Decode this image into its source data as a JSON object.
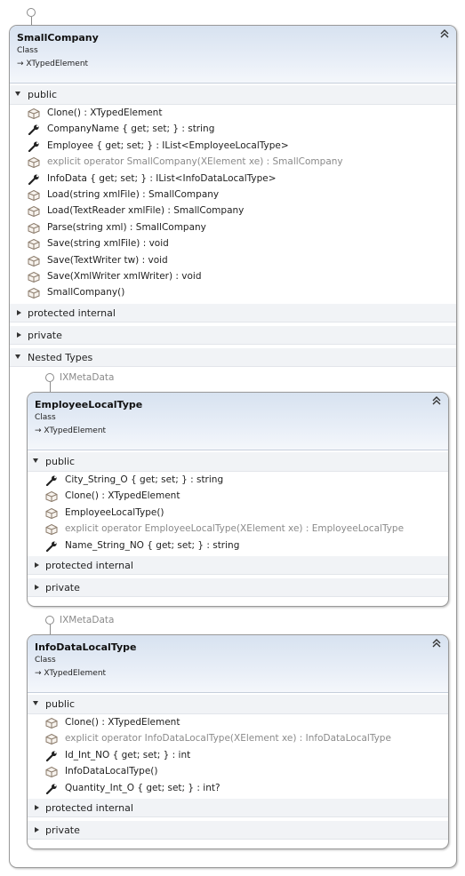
{
  "outer_interface": {
    "label": ""
  },
  "small_company": {
    "title": "SmallCompany",
    "kind": "Class",
    "base": "XTypedElement",
    "sections": {
      "public": "public",
      "protected_internal": "protected internal",
      "private": "private",
      "nested": "Nested Types"
    },
    "members": [
      {
        "text": "Clone() : XTypedElement",
        "icon": "method-icon",
        "gray": false
      },
      {
        "text": "CompanyName { get; set; } : string",
        "icon": "property-icon",
        "gray": false
      },
      {
        "text": "Employee { get; set; } : IList<EmployeeLocalType>",
        "icon": "property-icon",
        "gray": false
      },
      {
        "text": "explicit operator SmallCompany(XElement xe) : SmallCompany",
        "icon": "method-icon",
        "gray": true
      },
      {
        "text": "InfoData { get; set; } : IList<InfoDataLocalType>",
        "icon": "property-icon",
        "gray": false
      },
      {
        "text": "Load(string xmlFile) : SmallCompany",
        "icon": "method-icon",
        "gray": false
      },
      {
        "text": "Load(TextReader xmlFile) : SmallCompany",
        "icon": "method-icon",
        "gray": false
      },
      {
        "text": "Parse(string xml) : SmallCompany",
        "icon": "method-icon",
        "gray": false
      },
      {
        "text": "Save(string xmlFile) : void",
        "icon": "method-icon",
        "gray": false
      },
      {
        "text": "Save(TextWriter tw) : void",
        "icon": "method-icon",
        "gray": false
      },
      {
        "text": "Save(XmlWriter xmlWriter) : void",
        "icon": "method-icon",
        "gray": false
      },
      {
        "text": "SmallCompany()",
        "icon": "method-icon",
        "gray": false
      }
    ]
  },
  "employee_local_type": {
    "interface": "IXMetaData",
    "title": "EmployeeLocalType",
    "kind": "Class",
    "base": "XTypedElement",
    "sections": {
      "public": "public",
      "protected_internal": "protected internal",
      "private": "private"
    },
    "members": [
      {
        "text": "City_String_O { get; set; } : string",
        "icon": "property-icon",
        "gray": false
      },
      {
        "text": "Clone() : XTypedElement",
        "icon": "method-icon",
        "gray": false
      },
      {
        "text": "EmployeeLocalType()",
        "icon": "method-icon",
        "gray": false
      },
      {
        "text": "explicit operator EmployeeLocalType(XElement xe) : EmployeeLocalType",
        "icon": "method-icon",
        "gray": true
      },
      {
        "text": "Name_String_NO { get; set; } : string",
        "icon": "property-icon",
        "gray": false
      }
    ]
  },
  "info_data_local_type": {
    "interface": "IXMetaData",
    "title": "InfoDataLocalType",
    "kind": "Class",
    "base": "XTypedElement",
    "sections": {
      "public": "public",
      "protected_internal": "protected internal",
      "private": "private"
    },
    "members": [
      {
        "text": "Clone() : XTypedElement",
        "icon": "method-icon",
        "gray": false
      },
      {
        "text": "explicit operator InfoDataLocalType(XElement xe) : InfoDataLocalType",
        "icon": "method-icon",
        "gray": true
      },
      {
        "text": "Id_Int_NO { get; set; } : int",
        "icon": "property-icon",
        "gray": false
      },
      {
        "text": "InfoDataLocalType()",
        "icon": "method-icon",
        "gray": false
      },
      {
        "text": "Quantity_Int_O { get; set; } : int?",
        "icon": "property-icon",
        "gray": false
      }
    ]
  },
  "glyphs": {
    "collapse": "⌃⌃",
    "inherit_arrow": "⊸"
  }
}
